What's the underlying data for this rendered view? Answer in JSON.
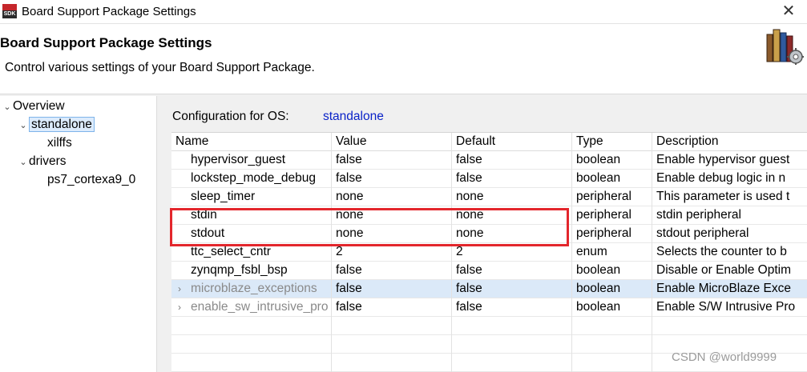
{
  "window": {
    "app_icon": "sdk-icon",
    "app_icon_text": "SDK",
    "title": "Board Support Package Settings",
    "close_icon": "close-icon"
  },
  "header": {
    "title": "Board Support Package Settings",
    "description": "Control various settings of your Board Support Package.",
    "icon": "books-gear-icon"
  },
  "tree": {
    "overview": "Overview",
    "standalone": "standalone",
    "xilffs": "xilffs",
    "drivers": "drivers",
    "ps7": "ps7_cortexa9_0"
  },
  "config": {
    "label": "Configuration for OS:",
    "os": "standalone"
  },
  "table": {
    "headers": [
      "Name",
      "Value",
      "Default",
      "Type",
      "Description"
    ],
    "rows": [
      {
        "name": "hypervisor_guest",
        "value": "false",
        "default": "false",
        "type": "boolean",
        "description": "Enable hypervisor guest"
      },
      {
        "name": "lockstep_mode_debug",
        "value": "false",
        "default": "false",
        "type": "boolean",
        "description": "Enable debug logic in n"
      },
      {
        "name": "sleep_timer",
        "value": "none",
        "default": "none",
        "type": "peripheral",
        "description": "This parameter is used t"
      },
      {
        "name": "stdin",
        "value": "none",
        "default": "none",
        "type": "peripheral",
        "description": "stdin peripheral"
      },
      {
        "name": "stdout",
        "value": "none",
        "default": "none",
        "type": "peripheral",
        "description": "stdout peripheral"
      },
      {
        "name": "ttc_select_cntr",
        "value": "2",
        "default": "2",
        "type": "enum",
        "description": "Selects the counter to b"
      },
      {
        "name": "zynqmp_fsbl_bsp",
        "value": "false",
        "default": "false",
        "type": "boolean",
        "description": "Disable or Enable Optim"
      },
      {
        "name": "microblaze_exceptions",
        "value": "false",
        "default": "false",
        "type": "boolean",
        "description": "Enable MicroBlaze Exce"
      },
      {
        "name": "enable_sw_intrusive_pro",
        "value": "false",
        "default": "false",
        "type": "boolean",
        "description": "Enable S/W Intrusive Pro"
      }
    ]
  },
  "watermark": "CSDN @world9999",
  "colors": {
    "highlight_box": "#e3262c",
    "link": "#0a22c8",
    "selected_row": "#dbe9f8"
  }
}
